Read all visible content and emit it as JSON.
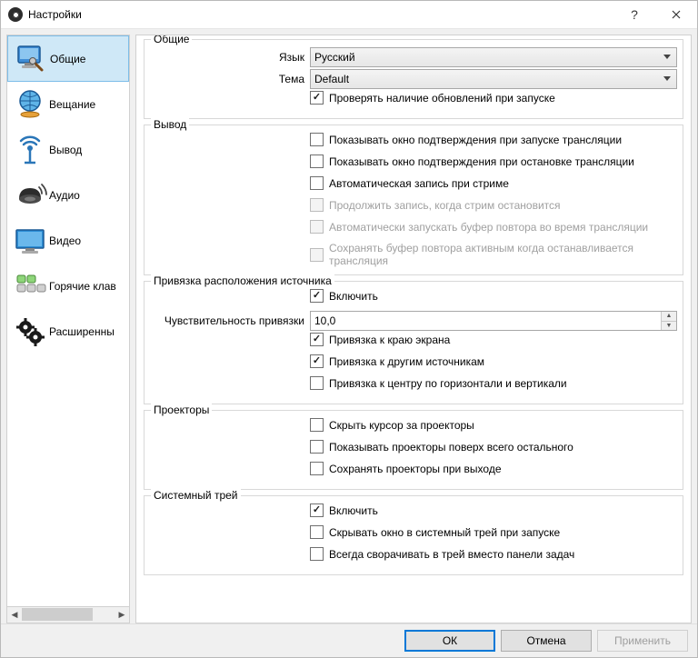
{
  "window": {
    "title": "Настройки"
  },
  "sidebar": {
    "items": [
      {
        "label": "Общие",
        "icon": "monitor-wrench"
      },
      {
        "label": "Вещание",
        "icon": "globe"
      },
      {
        "label": "Вывод",
        "icon": "antenna"
      },
      {
        "label": "Аудио",
        "icon": "speaker"
      },
      {
        "label": "Видео",
        "icon": "display"
      },
      {
        "label": "Горячие клав",
        "icon": "keyboard"
      },
      {
        "label": "Расширенны",
        "icon": "gears"
      }
    ]
  },
  "groups": {
    "general": {
      "legend": "Общие",
      "language_label": "Язык",
      "language_value": "Русский",
      "theme_label": "Тема",
      "theme_value": "Default",
      "check_updates": "Проверять наличие обновлений при запуске"
    },
    "output": {
      "legend": "Вывод",
      "confirm_start": "Показывать окно подтверждения при запуске трансляции",
      "confirm_stop": "Показывать окно подтверждения при остановке трансляции",
      "auto_record": "Автоматическая запись при стриме",
      "keep_recording": "Продолжить запись, когда стрим остановится",
      "auto_replay": "Автоматически запускать буфер повтора во время трансляции",
      "keep_replay": "Сохранять буфер повтора активным когда останавливается трансляция"
    },
    "snapping": {
      "legend": "Привязка расположения источника",
      "enable": "Включить",
      "sensitivity_label": "Чувствительность привязки",
      "sensitivity_value": "10,0",
      "edge": "Привязка к краю экрана",
      "other": "Привязка к другим источникам",
      "center": "Привязка к центру по горизонтали и вертикали"
    },
    "projectors": {
      "legend": "Проекторы",
      "hide_cursor": "Скрыть курсор за проекторы",
      "on_top": "Показывать проекторы поверх всего остального",
      "save_exit": "Сохранять проекторы при выходе"
    },
    "tray": {
      "legend": "Системный трей",
      "enable": "Включить",
      "minimize_start": "Скрывать окно в системный трей при запуске",
      "always_minimize": "Всегда сворачивать в трей вместо панели задач"
    }
  },
  "buttons": {
    "ok": "ОК",
    "cancel": "Отмена",
    "apply": "Применить"
  }
}
